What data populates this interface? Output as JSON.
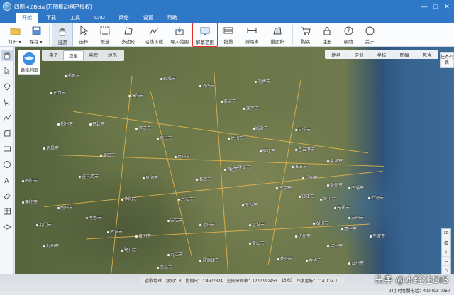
{
  "app": {
    "title": "四图 4.0Beta [万图振动器已授权]"
  },
  "window_controls": [
    "—",
    "□",
    "✕"
  ],
  "menu": [
    {
      "label": "开始",
      "active": true
    },
    {
      "label": "下载"
    },
    {
      "label": "工具"
    },
    {
      "label": "CAD"
    },
    {
      "label": "网络"
    },
    {
      "label": "设置"
    },
    {
      "label": "帮助"
    }
  ],
  "toolbar": {
    "open": "打开",
    "save": "保存",
    "pan": "漫游",
    "select": "选择",
    "rect_select": "框选",
    "polygon": "多边形",
    "line_download": "沿线下载",
    "import_range": "导入范围",
    "screen_range": "屏幕范围",
    "batch": "批量",
    "measure_height": "测距离",
    "measure_area": "量面积",
    "buy": "购买",
    "register": "注册",
    "help": "帮助",
    "about": "关于"
  },
  "map_types": [
    {
      "label": "电子"
    },
    {
      "label": "卫星",
      "active": true
    },
    {
      "label": "高程"
    },
    {
      "label": "地形"
    }
  ],
  "choose_map_label": "选择地图",
  "layer_bar": [
    "地名",
    "区划",
    "坐标",
    "图幅",
    "瓦片"
  ],
  "task_panel_label": "任务列表",
  "zoom_controls": [
    "3D",
    "⊕",
    "+",
    "−",
    "⌂"
  ],
  "cities": [
    {
      "name": "邯郸市"
    },
    {
      "name": "聊城市"
    },
    {
      "name": "济南市"
    },
    {
      "name": "淄博市"
    },
    {
      "name": "泰安市"
    },
    {
      "name": "莱芜市"
    },
    {
      "name": "邢台市"
    },
    {
      "name": "濮阳市"
    },
    {
      "name": "菏泽市"
    },
    {
      "name": "临沂市"
    },
    {
      "name": "日照市"
    },
    {
      "name": "连云港市"
    },
    {
      "name": "开封市"
    },
    {
      "name": "郑州市"
    },
    {
      "name": "商丘市"
    },
    {
      "name": "徐州市"
    },
    {
      "name": "宿迁市"
    },
    {
      "name": "淮安市"
    },
    {
      "name": "盐城市"
    },
    {
      "name": "许昌市"
    },
    {
      "name": "周口市"
    },
    {
      "name": "亳州市"
    },
    {
      "name": "蚌埠市"
    },
    {
      "name": "扬州市"
    },
    {
      "name": "泰州市"
    },
    {
      "name": "南通市"
    },
    {
      "name": "南阳市"
    },
    {
      "name": "驻马店市"
    },
    {
      "name": "阜阳市"
    },
    {
      "name": "淮南市"
    },
    {
      "name": "合肥市"
    },
    {
      "name": "南京市"
    },
    {
      "name": "镇江市"
    },
    {
      "name": "常州市"
    },
    {
      "name": "无锡市"
    },
    {
      "name": "苏州市"
    },
    {
      "name": "上海市"
    },
    {
      "name": "信阳市"
    },
    {
      "name": "六安市"
    },
    {
      "name": "芜湖市"
    },
    {
      "name": "湖州市"
    },
    {
      "name": "嘉兴市"
    },
    {
      "name": "襄阳市"
    },
    {
      "name": "随州市"
    },
    {
      "name": "孝感市"
    },
    {
      "name": "安庆市"
    },
    {
      "name": "池州市"
    },
    {
      "name": "宣城市"
    },
    {
      "name": "杭州市"
    },
    {
      "name": "绍兴市"
    },
    {
      "name": "宁波市"
    },
    {
      "name": "荆门市"
    },
    {
      "name": "武汉市"
    },
    {
      "name": "黄冈市"
    },
    {
      "name": "黄山市"
    },
    {
      "name": "荆州市"
    },
    {
      "name": "鄂州市"
    },
    {
      "name": "九江市"
    },
    {
      "name": "景德镇市"
    },
    {
      "name": "衢州市"
    },
    {
      "name": "金华市"
    },
    {
      "name": "台州市"
    },
    {
      "name": "南昌市"
    }
  ],
  "status": {
    "source": "谷歌地球",
    "level": "级别：8",
    "scale": "比例尺：1:4622324",
    "resolution": "空间分辨率：1222.992453",
    "level_progress": "16.60",
    "coords": "纬度坐标：114.0 34.1"
  },
  "watermark": "头条 @水经注GIS",
  "hotline": "24小时客服电话：400-028-0050"
}
